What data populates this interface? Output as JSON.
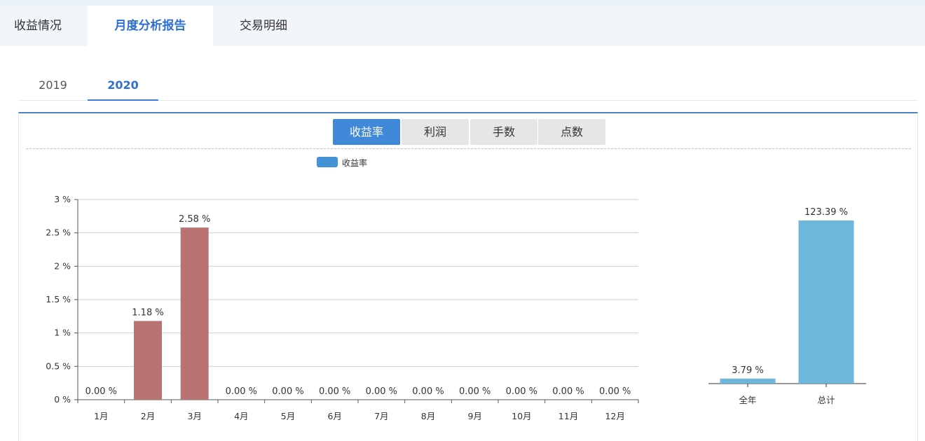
{
  "main_tabs": [
    {
      "label": "收益情况",
      "active": false
    },
    {
      "label": "月度分析报告",
      "active": true
    },
    {
      "label": "交易明细",
      "active": false
    }
  ],
  "year_tabs": [
    {
      "label": "2019",
      "active": false
    },
    {
      "label": "2020",
      "active": true
    }
  ],
  "metric_buttons": [
    {
      "label": "收益率",
      "active": true
    },
    {
      "label": "利润",
      "active": false
    },
    {
      "label": "手数",
      "active": false
    },
    {
      "label": "点数",
      "active": false
    }
  ],
  "colors": {
    "accent": "#2e6fd0",
    "monthly_bar": "#b87372",
    "summary_bar": "#6fb6dc",
    "legend_swatch": "#4393d6"
  },
  "chart_data": [
    {
      "type": "bar",
      "legend": [
        "收益率"
      ],
      "categories": [
        "1月",
        "2月",
        "3月",
        "4月",
        "5月",
        "6月",
        "7月",
        "8月",
        "9月",
        "10月",
        "11月",
        "12月"
      ],
      "values": [
        0.0,
        1.18,
        2.58,
        0.0,
        0.0,
        0.0,
        0.0,
        0.0,
        0.0,
        0.0,
        0.0,
        0.0
      ],
      "data_labels": [
        "0.00 %",
        "1.18 %",
        "2.58 %",
        "0.00 %",
        "0.00 %",
        "0.00 %",
        "0.00 %",
        "0.00 %",
        "0.00 %",
        "0.00 %",
        "0.00 %",
        "0.00 %"
      ],
      "y_ticks": [
        "0 %",
        "0.5 %",
        "1 %",
        "1.5 %",
        "2 %",
        "2.5 %",
        "3 %"
      ],
      "y_tick_values": [
        0,
        0.5,
        1,
        1.5,
        2,
        2.5,
        3
      ],
      "ylim": [
        0,
        3
      ],
      "grid": true
    },
    {
      "type": "bar",
      "categories": [
        "全年",
        "总计"
      ],
      "values": [
        3.79,
        123.39
      ],
      "data_labels": [
        "3.79 %",
        "123.39 %"
      ],
      "grid": false
    }
  ]
}
